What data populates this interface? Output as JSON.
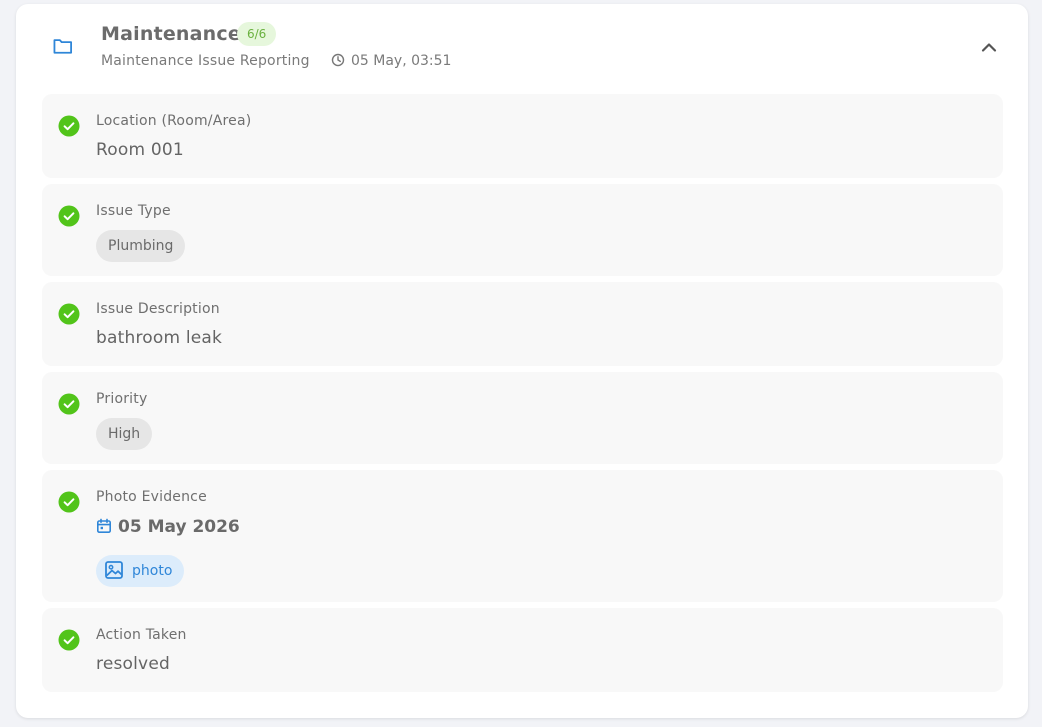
{
  "section": {
    "title": "Maintenance",
    "badge": "6/6",
    "subtitle": "Maintenance Issue Reporting",
    "timestamp": "05 May, 03:51",
    "icons": {
      "folder": "folder-icon",
      "clock": "clock-icon",
      "collapse": "chevron-up-icon"
    }
  },
  "colors": {
    "accent": "#2f86d8",
    "success": "#52c41a",
    "badge_bg": "#e6f7dc",
    "badge_text": "#6ab13f"
  },
  "fields": [
    {
      "label": "Location (Room/Area)",
      "value": "Room 001"
    },
    {
      "label": "Issue Type",
      "chip": "Plumbing"
    },
    {
      "label": "Issue Description",
      "value": "bathroom leak"
    },
    {
      "label": "Priority",
      "chip": "High"
    },
    {
      "label": "Photo Evidence",
      "date": "05 May 2026",
      "attachment": "photo"
    },
    {
      "label": "Action Taken",
      "value": "resolved"
    }
  ]
}
